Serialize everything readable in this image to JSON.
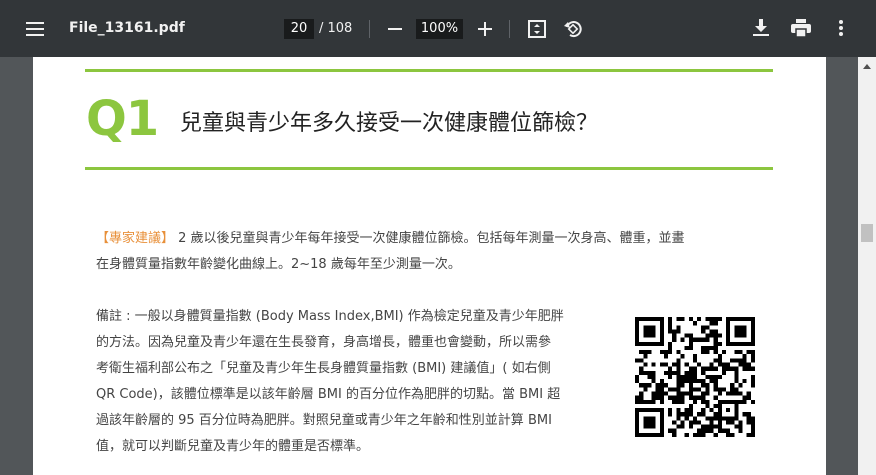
{
  "toolbar": {
    "filename": "File_13161.pdf",
    "page_current": "20",
    "page_total": "/ 108",
    "zoom": "100%",
    "icons": [
      "menu-icon",
      "zoom-out-icon",
      "zoom-in-icon",
      "fit-page-icon",
      "rotate-icon",
      "download-icon",
      "print-icon",
      "more-vert-icon"
    ]
  },
  "document": {
    "q_label": "Q1",
    "heading": "兒童與青少年多久接受一次健康體位篩檢？",
    "advice_label": "【專家建議】",
    "advice_line1": " 2 歲以後兒童與青少年每年接受一次健康體位篩檢。包括每年測量一次身高、體重，並畫",
    "advice_line2": "在身體質量指數年齡變化曲線上。2~18 歲每年至少測量一次。",
    "note_lines": [
      "備註 : 一般以身體質量指數 (Body Mass Index,BMI) 作為檢定兒童及青少年肥胖",
      "的方法。因為兒童及青少年還在生長發育，身高增長，體重也會變動，所以需參",
      "考衛生福利部公布之「兒童及青少年生長身體質量指數 (BMI) 建議值」( 如右側",
      "QR Code)，該體位標準是以該年齡層 BMI 的百分位作為肥胖的切點。當 BMI 超",
      "過該年齡層的 95 百分位時為肥胖。對照兒童或青少年之年齡和性別並計算 BMI",
      "值，就可以判斷兒童及青少年的體重是否標準。"
    ]
  },
  "colors": {
    "accent_green": "#8cc63f",
    "advice_orange": "#e8903a",
    "toolbar_bg": "#323639"
  }
}
